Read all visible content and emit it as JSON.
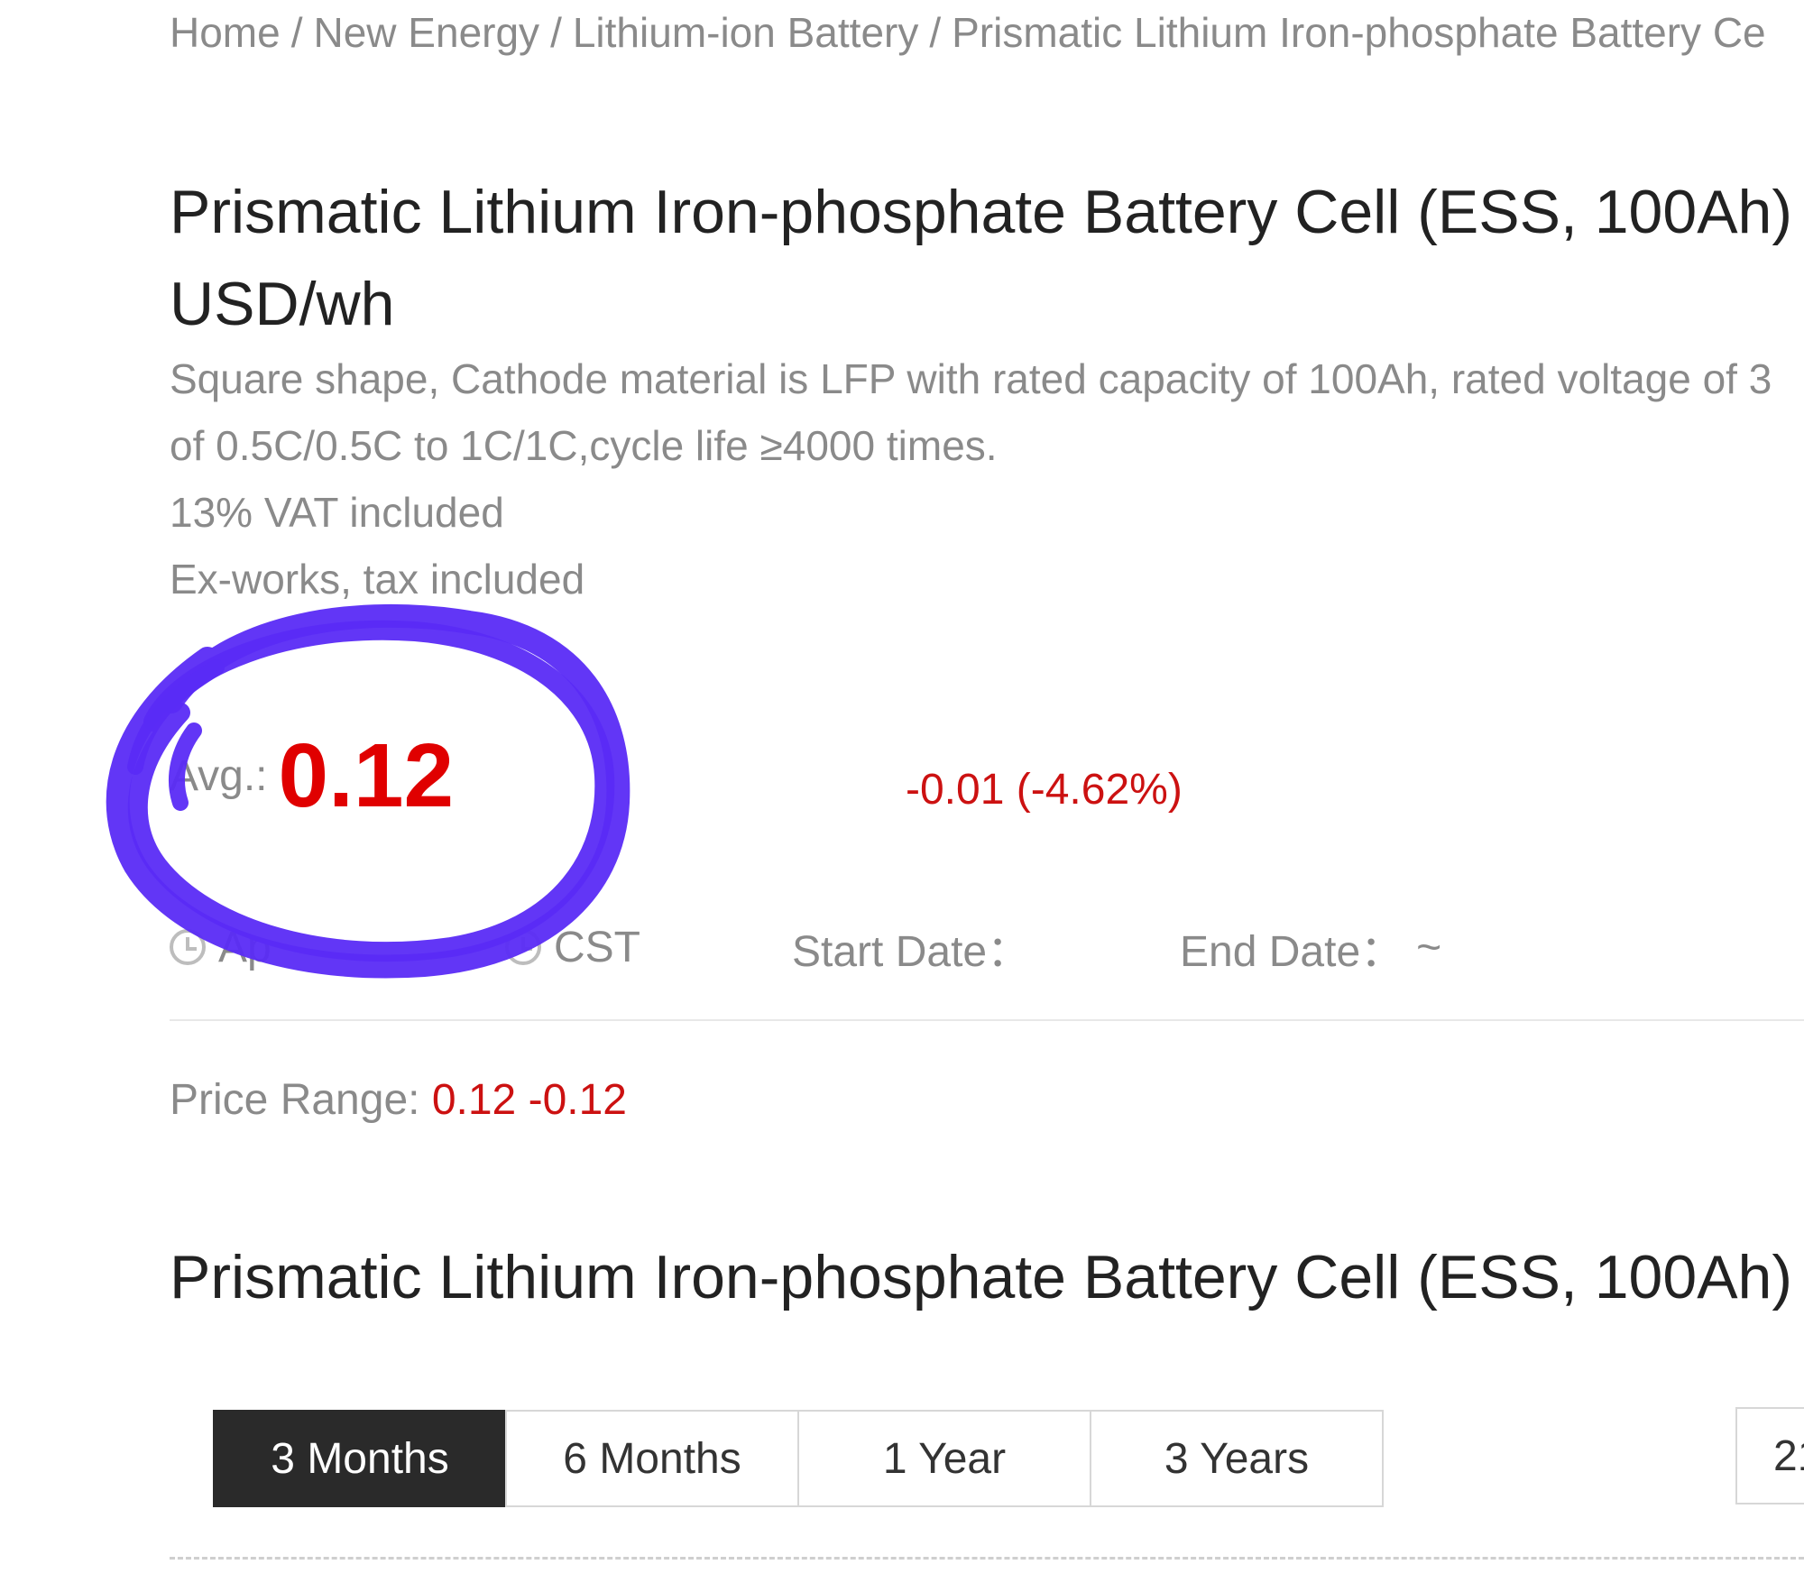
{
  "breadcrumb": {
    "items": [
      "Home",
      "New Energy",
      "Lithium-ion Battery",
      "Prismatic Lithium Iron-phosphate Battery Ce"
    ],
    "separator": "/"
  },
  "product": {
    "title_line1": "Prismatic Lithium Iron-phosphate Battery Cell (ESS, 100Ah) (",
    "title_line2": "USD/wh",
    "desc_line1": "Square shape, Cathode material is LFP with rated capacity of 100Ah, rated voltage of 3",
    "desc_line2": "of 0.5C/0.5C to 1C/1C,cycle life ≥4000 times.",
    "vat_note": "13% VAT included",
    "terms_note": "Ex-works, tax included"
  },
  "price": {
    "avg_label": "Avg.:",
    "avg_value": "0.12",
    "change": "-0.01 (-4.62%)",
    "range_label": "Price Range:",
    "range_value": "0.12 -0.12"
  },
  "dates": {
    "updated_partial": "Ap",
    "timezone": "CST",
    "start_label": "Start Date：",
    "end_label": "End Date：",
    "end_value": "~"
  },
  "chart_section": {
    "title": "Prismatic Lithium Iron-phosphate Battery Cell (ESS, 100Ah) (",
    "tabs": [
      "3 Months",
      "6 Months",
      "1 Year",
      "3 Years"
    ],
    "active_tab": "3 Months",
    "date_box_partial": "21"
  },
  "colors": {
    "accent_red": "#e00000",
    "change_red": "#cc1111",
    "annotation": "#5a2bf5",
    "active_tab_bg": "#2a2a2a"
  },
  "icons": {
    "clock": "clock-icon",
    "timezone": "globe-icon"
  }
}
